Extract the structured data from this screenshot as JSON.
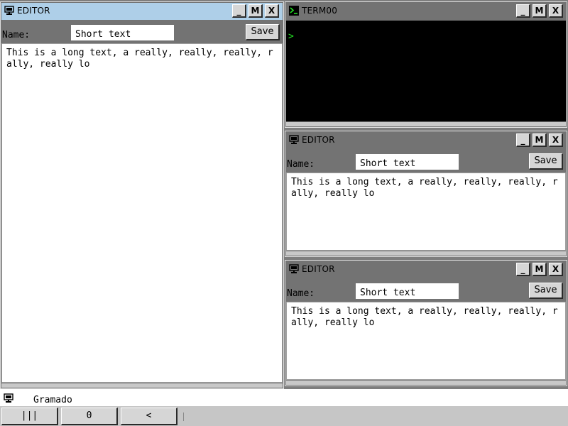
{
  "windows": {
    "editor_main": {
      "title": "EDITOR",
      "name_label": "Name:",
      "name_value": "Short text",
      "save_label": "Save",
      "body_text": "This is a long text, a really, really, really, r\nally, really lo",
      "buttons": {
        "minimize": "_",
        "maximize": "M",
        "close": "X"
      }
    },
    "terminal": {
      "title": "TERM00",
      "prompt": ">",
      "buttons": {
        "minimize": "_",
        "maximize": "M",
        "close": "X"
      }
    },
    "editor_2": {
      "title": "EDITOR",
      "name_label": "Name:",
      "name_value": "Short text",
      "save_label": "Save",
      "body_text": "This is a long text, a really, really, really, r\nally, really lo",
      "buttons": {
        "minimize": "_",
        "maximize": "M",
        "close": "X"
      }
    },
    "editor_3": {
      "title": "EDITOR",
      "name_label": "Name:",
      "name_value": "Short text",
      "save_label": "Save",
      "body_text": "This is a long text, a really, really, really, r\nally, really lo",
      "buttons": {
        "minimize": "_",
        "maximize": "M",
        "close": "X"
      }
    }
  },
  "taskbar": {
    "active_title": "Gramado",
    "buttons": [
      "|||",
      "0",
      "<"
    ]
  },
  "colors": {
    "desktop": "#7d7d7d",
    "active_titlebar": "#aecfe8",
    "inactive_titlebar": "#737373",
    "terminal_prompt": "#22e022"
  }
}
